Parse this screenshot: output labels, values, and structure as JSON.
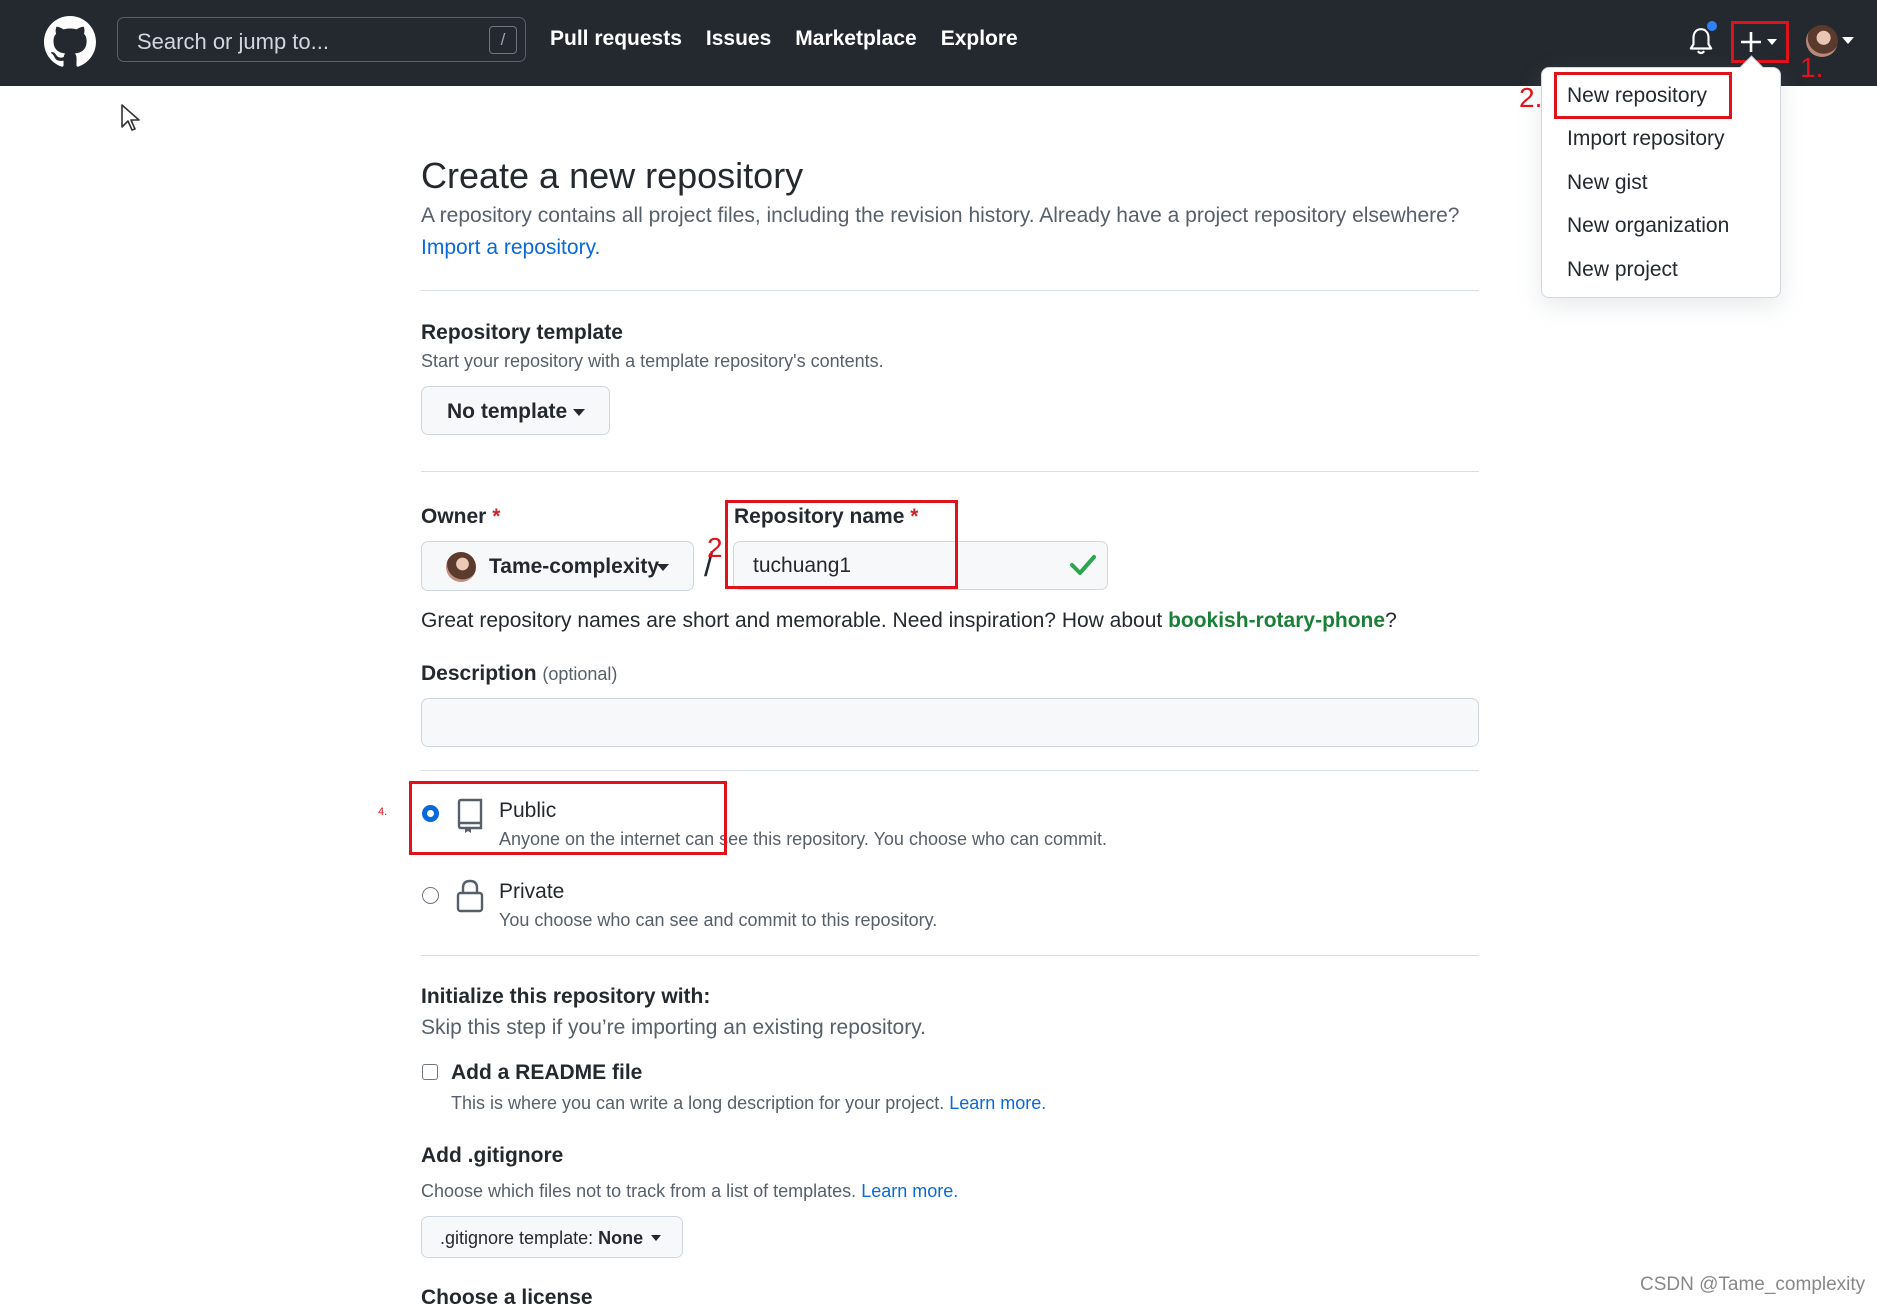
{
  "header": {
    "search_placeholder": "Search or jump to...",
    "search_shortcut": "/",
    "nav": [
      "Pull requests",
      "Issues",
      "Marketplace",
      "Explore"
    ],
    "logo_icon": "github-mark-icon",
    "bell_icon": "bell-icon",
    "plus_icon": "plus-icon",
    "accent_color": "#2f81f7"
  },
  "create_menu": {
    "items": [
      "New repository",
      "Import repository",
      "New gist",
      "New organization",
      "New project"
    ]
  },
  "annotations": {
    "step1": "1.",
    "step2_menu": "2.",
    "step2_name": "2.",
    "step4": "4.",
    "color": "#e0121b"
  },
  "page": {
    "title": "Create a new repository",
    "subtitle": "A repository contains all project files, including the revision history. Already have a project repository elsewhere?",
    "import_link": "Import a repository.",
    "template": {
      "label": "Repository template",
      "note": "Start your repository with a template repository's contents.",
      "button": "No template"
    },
    "owner": {
      "label": "Owner",
      "required": "*",
      "value": "Tame-complexity"
    },
    "slash": "/",
    "repo_name": {
      "label": "Repository name",
      "required": "*",
      "value": "tuchuang1"
    },
    "hint_prefix": "Great repository names are short and memorable. Need inspiration? How about ",
    "hint_suggestion": "bookish-rotary-phone",
    "hint_suffix": "?",
    "description": {
      "label": "Description",
      "optional": "(optional)",
      "value": ""
    },
    "visibility": {
      "selected": "Public",
      "public_title": "Public",
      "public_note": "Anyone on the internet can see this repository. You choose who can commit.",
      "private_title": "Private",
      "private_note": "You choose who can see and commit to this repository."
    },
    "initialize": {
      "label": "Initialize this repository with:",
      "note": "Skip this step if you’re importing an existing repository.",
      "readme_title": "Add a README file",
      "readme_note": "This is where you can write a long description for your project.",
      "readme_link": "Learn more.",
      "readme_checked": false
    },
    "gitignore": {
      "label": "Add .gitignore",
      "note": "Choose which files not to track from a list of templates.",
      "link": "Learn more.",
      "button_prefix": ".gitignore template: ",
      "button_value": "None"
    },
    "license": {
      "label": "Choose a license"
    }
  },
  "watermark": "CSDN @Tame_complexity"
}
